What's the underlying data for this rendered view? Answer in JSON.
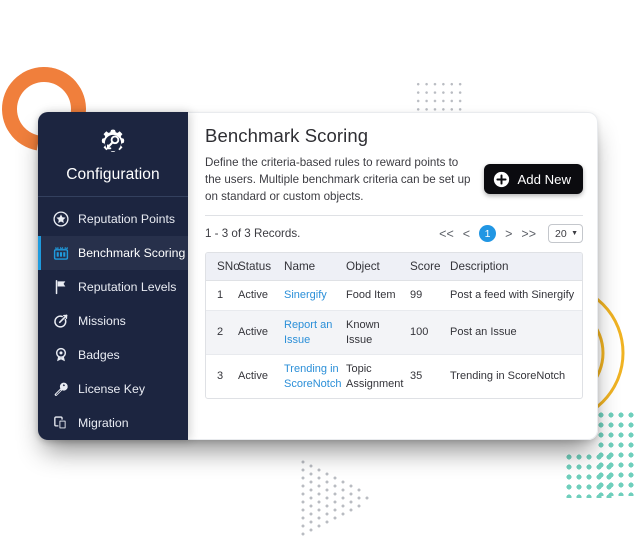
{
  "window": {
    "brand": {
      "label": "Configuration",
      "icon": "gear-wrench-icon"
    },
    "nav": [
      {
        "label": "Reputation Points",
        "icon": "star-circle-icon",
        "active": false
      },
      {
        "label": "Benchmark Scoring",
        "icon": "podium-icon",
        "active": true
      },
      {
        "label": "Reputation Levels",
        "icon": "flag-icon",
        "active": false
      },
      {
        "label": "Missions",
        "icon": "dart-target-icon",
        "active": false
      },
      {
        "label": "Badges",
        "icon": "badge-ribbon-icon",
        "active": false
      },
      {
        "label": "License Key",
        "icon": "wrench-icon",
        "active": false
      },
      {
        "label": "Migration",
        "icon": "copy-stack-icon",
        "active": false
      }
    ]
  },
  "main": {
    "title": "Benchmark Scoring",
    "description": "Define the criteria-based rules to reward points to the users. Multiple benchmark criteria can be set up on standard or custom objects.",
    "add_new_label": "Add New",
    "add_new_icon": "plus-circle-icon",
    "record_count": "1 - 3 of 3 Records.",
    "pager": {
      "first": "<<",
      "prev": "<",
      "current": "1",
      "next": ">",
      "last": ">>",
      "page_size": "20",
      "page_size_caret": "▼"
    },
    "table": {
      "columns": [
        "SNo",
        "Status",
        "Name",
        "Object",
        "Score",
        "Description"
      ],
      "rows": [
        {
          "sno": "1",
          "status": "Active",
          "name": "Sinergify",
          "object": "Food Item",
          "score": "99",
          "description": "Post a feed with Sinergify"
        },
        {
          "sno": "2",
          "status": "Active",
          "name": "Report an Issue",
          "object": "Known Issue",
          "score": "100",
          "description": "Post an Issue"
        },
        {
          "sno": "3",
          "status": "Active",
          "name": "Trending in ScoreNotch",
          "object": "Topic Assignment",
          "score": "35",
          "description": "Trending in ScoreNotch"
        }
      ]
    }
  },
  "colors": {
    "sidebar_bg": "#1c2540",
    "accent_blue": "#2196e3",
    "link_blue": "#2b8fd8",
    "orange_ring": "#f07f3c",
    "yellow_arc": "#f0b323",
    "teal_dots": "#6fcfbc",
    "button_black": "#0b0b0f"
  }
}
